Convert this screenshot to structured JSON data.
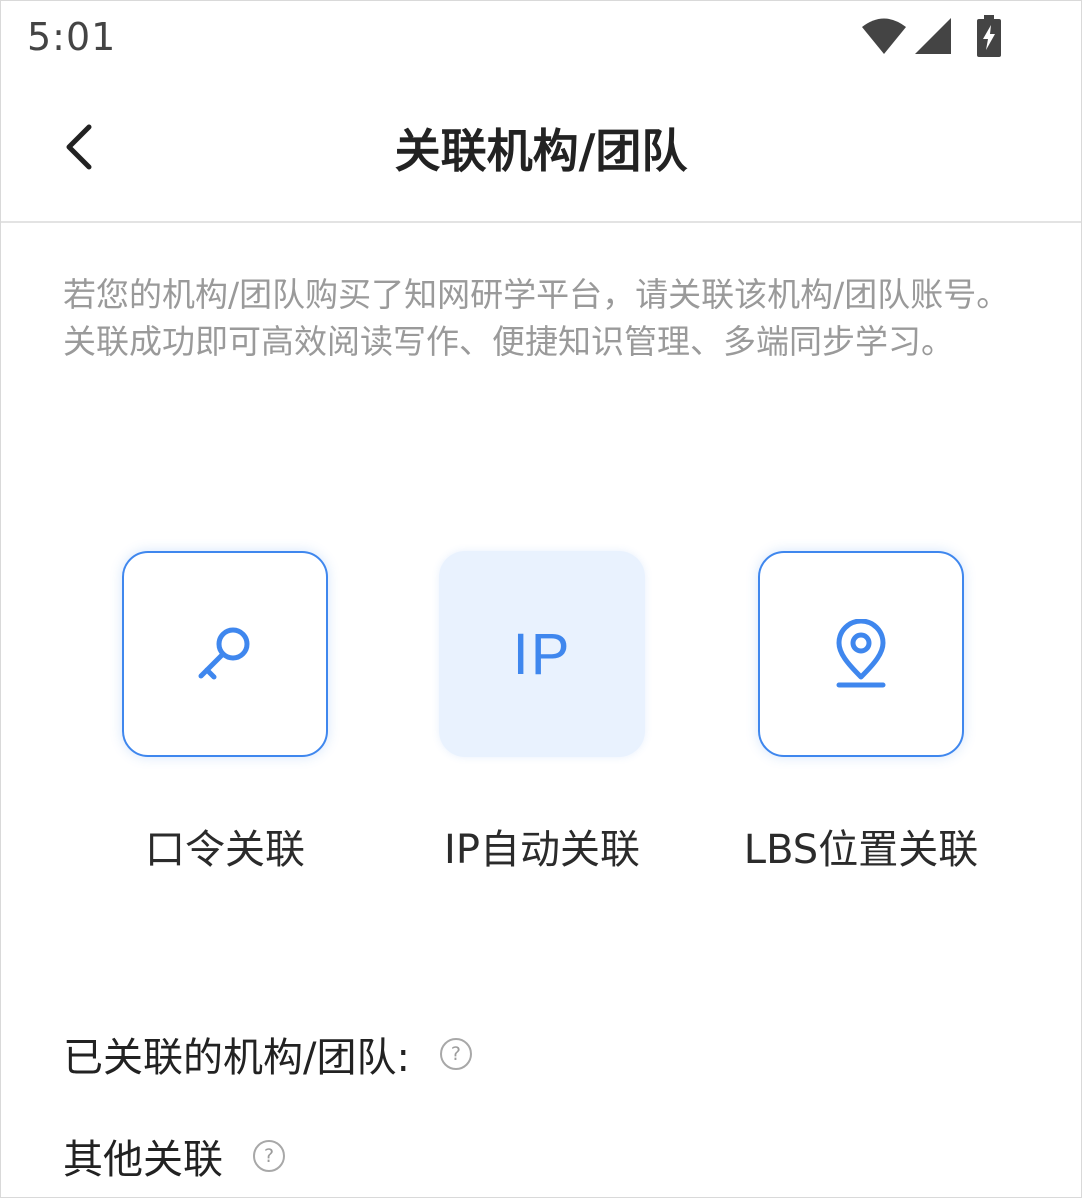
{
  "status_bar": {
    "time": "5:01",
    "icons": [
      "wifi-icon",
      "cellular-signal-icon",
      "battery-charging-icon"
    ]
  },
  "header": {
    "back_icon": "chevron-left-icon",
    "title": "关联机构/团队"
  },
  "description": "若您的机构/团队购买了知网研学平台，请关联该机构/团队账号。关联成功即可高效阅读写作、便捷知识管理、多端同步学习。",
  "options": [
    {
      "label": "口令关联",
      "icon": "key-icon",
      "selected": false
    },
    {
      "label": "IP自动关联",
      "icon_text": "IP",
      "selected": true
    },
    {
      "label": "LBS位置关联",
      "icon": "location-pin-icon",
      "selected": false
    }
  ],
  "linked_section": {
    "label": "已关联的机构/团队:",
    "help_icon": "question-circle-icon",
    "help_glyph": "?"
  },
  "other_section": {
    "label": "其他关联",
    "help_icon": "question-circle-icon",
    "help_glyph": "?"
  },
  "colors": {
    "accent": "#3f87ee",
    "selected_background": "#e9f2fe",
    "description_text": "#9a9a9a",
    "title_text": "#222222"
  }
}
